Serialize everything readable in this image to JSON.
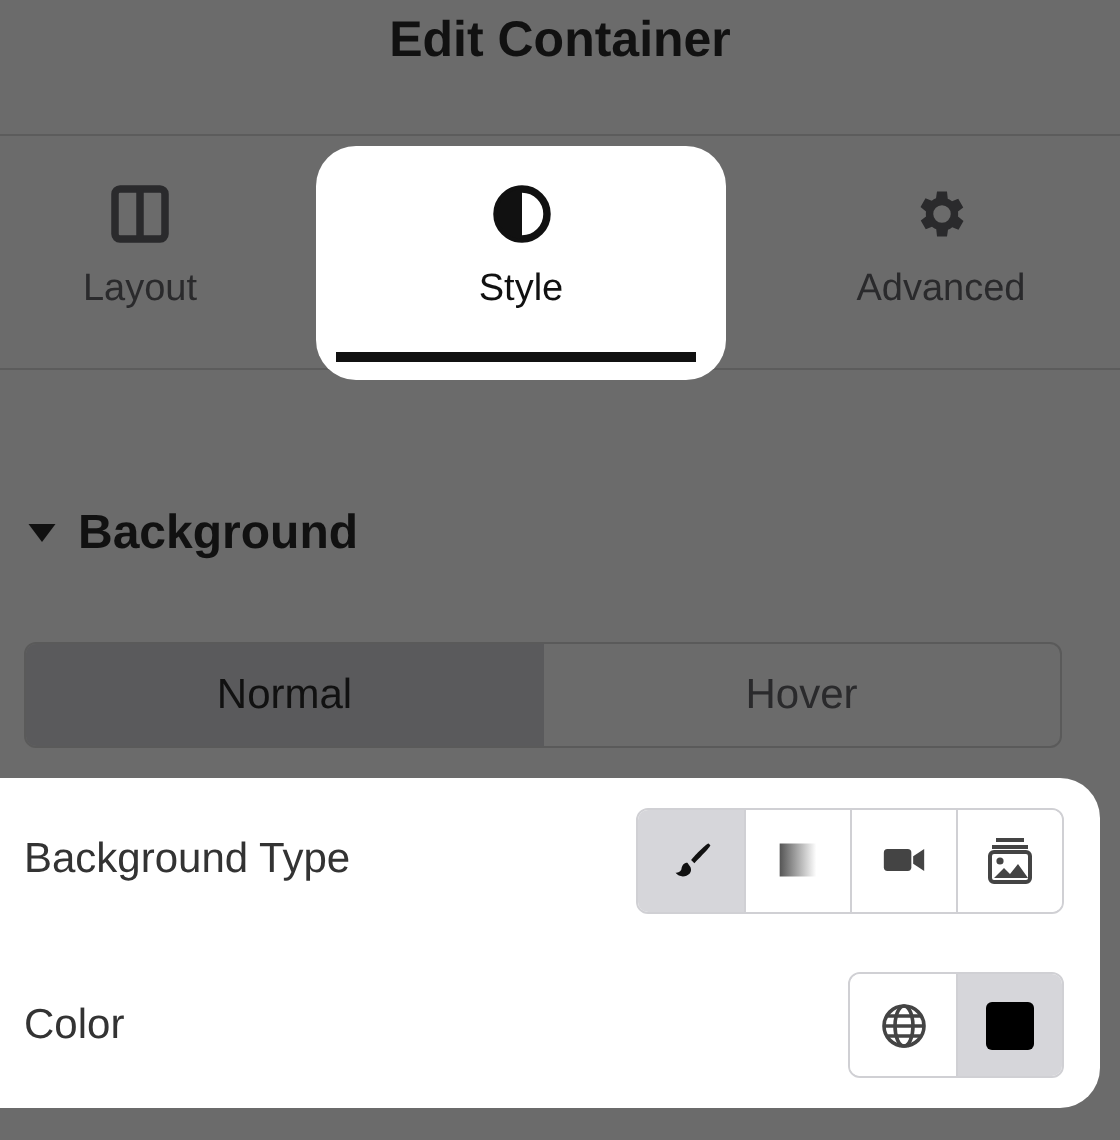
{
  "panel": {
    "title": "Edit Container"
  },
  "tabs": [
    {
      "label": "Layout",
      "kind": "columns",
      "selected": false,
      "highlighted": false
    },
    {
      "label": "Style",
      "kind": "contrast",
      "selected": true,
      "highlighted": true
    },
    {
      "label": "Advanced",
      "kind": "gear",
      "selected": false,
      "highlighted": false
    }
  ],
  "section": {
    "title": "Background",
    "expanded": true
  },
  "state_tabs": [
    {
      "label": "Normal",
      "selected": true
    },
    {
      "label": "Hover",
      "selected": false
    }
  ],
  "controls_highlighted": true,
  "controls": [
    {
      "label": "Background Type",
      "options": [
        {
          "kind": "brush",
          "selected": true
        },
        {
          "kind": "gradient",
          "selected": false
        },
        {
          "kind": "video",
          "selected": false
        },
        {
          "kind": "slideshow",
          "selected": false
        }
      ]
    },
    {
      "label": "Color",
      "options": [
        {
          "kind": "globe",
          "selected": false
        },
        {
          "kind": "swatch",
          "selected": true,
          "color": "#000000"
        }
      ]
    }
  ]
}
